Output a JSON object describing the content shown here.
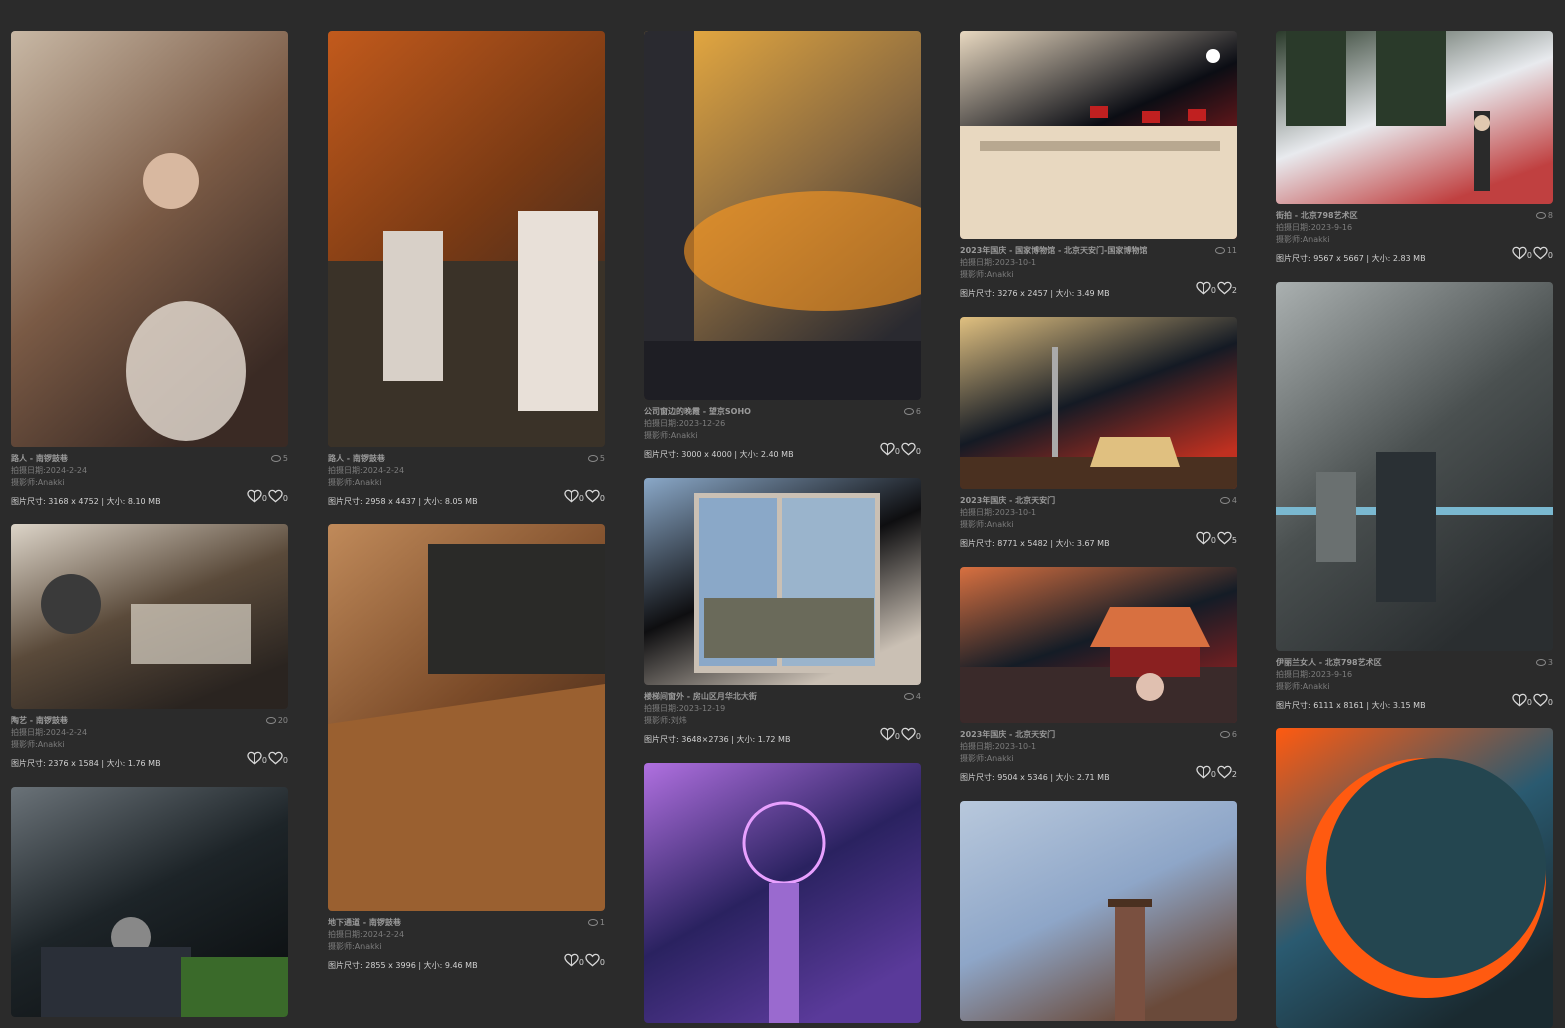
{
  "labels": {
    "date_prefix": "拍摄日期:",
    "photographer_prefix": "摄影师:",
    "size_prefix": "图片尺寸: ",
    "filesize_prefix": " | 大小: "
  },
  "photos": [
    {
      "title": "路人 - 南锣鼓巷",
      "views": "5",
      "date": "2024-2-24",
      "photographer": "Anakki",
      "dims": "3168 x 4752",
      "filesize": "8.10 MB",
      "likes": "0",
      "favs": "0",
      "colors": [
        "#7a5a45",
        "#c8b8a5",
        "#3a2a24"
      ]
    },
    {
      "title": "陶艺 - 南锣鼓巷",
      "views": "20",
      "date": "2024-2-24",
      "photographer": "Anakki",
      "dims": "2376 x 1584",
      "filesize": "1.76 MB",
      "likes": "0",
      "favs": "0",
      "colors": [
        "#5a4a3a",
        "#dcd4c8",
        "#2a2420"
      ]
    },
    {
      "title": "",
      "views": "",
      "date": "",
      "photographer": "",
      "dims": "",
      "filesize": "",
      "likes": "",
      "favs": "",
      "colors": [
        "#1d2428",
        "#6a7278",
        "#0e1214"
      ]
    },
    {
      "title": "路人 - 南锣鼓巷",
      "views": "5",
      "date": "2024-2-24",
      "photographer": "Anakki",
      "dims": "2958 x 4437",
      "filesize": "8.05 MB",
      "likes": "0",
      "favs": "0",
      "colors": [
        "#7a3a14",
        "#c25a1c",
        "#3a2a22"
      ]
    },
    {
      "title": "地下通道 - 南锣鼓巷",
      "views": "1",
      "date": "2024-2-24",
      "photographer": "Anakki",
      "dims": "2855 x 3996",
      "filesize": "9.46 MB",
      "likes": "0",
      "favs": "0",
      "colors": [
        "#7a4a28",
        "#c08a5a",
        "#3a2418"
      ]
    },
    {
      "title": "公司窗边的晚霞 - 望京SOHO",
      "views": "6",
      "date": "2023-12-26",
      "photographer": "Anakki",
      "dims": "3000 x 4000",
      "filesize": "2.40 MB",
      "likes": "0",
      "favs": "0",
      "colors": [
        "#8a6a40",
        "#f0b040",
        "#2a2a30"
      ]
    },
    {
      "title": "楼梯间窗外 - 房山区月华北大街",
      "views": "4",
      "date": "2023-12-19",
      "photographer": "刘炜",
      "dims": "3648×2736",
      "filesize": "1.72 MB",
      "likes": "0",
      "favs": "0",
      "colors": [
        "#0e0e10",
        "#8aa8c8",
        "#cac0b4"
      ]
    },
    {
      "title": "",
      "views": "",
      "date": "",
      "photographer": "",
      "dims": "",
      "filesize": "",
      "likes": "",
      "favs": "",
      "colors": [
        "#2a2260",
        "#b070e0",
        "#5a3a9a"
      ]
    },
    {
      "title": "2023年国庆 - 国家博物馆 - 北京天安门-国家博物馆",
      "views": "11",
      "date": "2023-10-1",
      "photographer": "Anakki",
      "dims": "3276 x 2457",
      "filesize": "3.49 MB",
      "likes": "0",
      "favs": "2",
      "colors": [
        "#0b0d14",
        "#e8d8c0",
        "#b02020"
      ]
    },
    {
      "title": "2023年国庆 - 北京天安门",
      "views": "4",
      "date": "2023-10-1",
      "photographer": "Anakki",
      "dims": "8771 x 5482",
      "filesize": "3.67 MB",
      "likes": "0",
      "favs": "5",
      "colors": [
        "#141a24",
        "#e0c080",
        "#c03020"
      ]
    },
    {
      "title": "2023年国庆 - 北京天安门",
      "views": "6",
      "date": "2023-10-1",
      "photographer": "Anakki",
      "dims": "9504 x 5346",
      "filesize": "2.71 MB",
      "likes": "0",
      "favs": "2",
      "colors": [
        "#141c26",
        "#d87040",
        "#8a2020"
      ]
    },
    {
      "title": "",
      "views": "",
      "date": "",
      "photographer": "",
      "dims": "",
      "filesize": "",
      "likes": "",
      "favs": "",
      "colors": [
        "#8ea6c8",
        "#b8c8dc",
        "#6a4a3a"
      ]
    },
    {
      "title": "街拍 - 北京798艺术区",
      "views": "8",
      "date": "2023-9-16",
      "photographer": "Anakki",
      "dims": "9567 x 5667",
      "filesize": "2.83 MB",
      "likes": "0",
      "favs": "0",
      "colors": [
        "#e8eaee",
        "#2a3a2a",
        "#c04040"
      ]
    },
    {
      "title": "伊丽兰女人 - 北京798艺术区",
      "views": "3",
      "date": "2023-9-16",
      "photographer": "Anakki",
      "dims": "6111 x 8161",
      "filesize": "3.15 MB",
      "likes": "0",
      "favs": "0",
      "colors": [
        "#4a5050",
        "#aab0b0",
        "#2a2e30"
      ]
    },
    {
      "title": "",
      "views": "",
      "date": "",
      "photographer": "",
      "dims": "",
      "filesize": "",
      "likes": "",
      "favs": "",
      "colors": [
        "#2a5a70",
        "#ff5a10",
        "#1a2a30"
      ]
    }
  ]
}
